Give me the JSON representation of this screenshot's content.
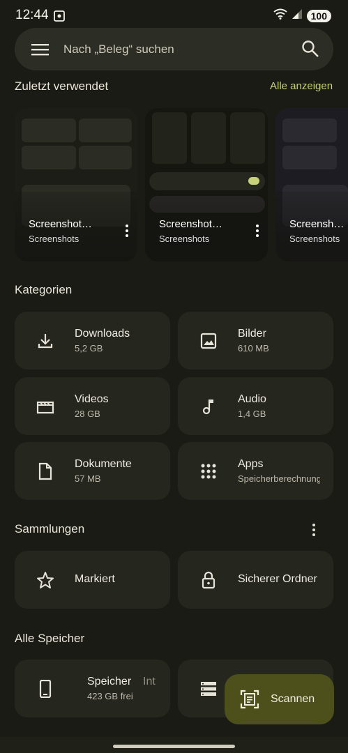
{
  "status_bar": {
    "time": "12:44",
    "battery": "100"
  },
  "search": {
    "placeholder": "Nach „Beleg“ suchen"
  },
  "recent": {
    "title": "Zuletzt verwendet",
    "show_all": "Alle anzeigen",
    "items": [
      {
        "title": "Screenshot…",
        "subtitle": "Screenshots"
      },
      {
        "title": "Screenshot…",
        "subtitle": "Screenshots"
      },
      {
        "title": "Screenshot…",
        "subtitle": "Screenshots"
      }
    ]
  },
  "categories": {
    "title": "Kategorien",
    "items": [
      {
        "label": "Downloads",
        "sub": "5,2 GB",
        "icon": "download-icon"
      },
      {
        "label": "Bilder",
        "sub": "610 MB",
        "icon": "image-icon"
      },
      {
        "label": "Videos",
        "sub": "28 GB",
        "icon": "movie-icon"
      },
      {
        "label": "Audio",
        "sub": "1,4 GB",
        "icon": "music-note-icon"
      },
      {
        "label": "Dokumente",
        "sub": "57 MB",
        "icon": "document-icon"
      },
      {
        "label": "Apps",
        "sub": "Speicherberechnung",
        "icon": "apps-grid-icon"
      }
    ]
  },
  "collections": {
    "title": "Sammlungen",
    "items": [
      {
        "label": "Markiert",
        "icon": "star-icon"
      },
      {
        "label": "Sicherer Ordner",
        "icon": "lock-icon"
      }
    ]
  },
  "storage": {
    "title": "Alle Speicher",
    "items": [
      {
        "label": "Speicher",
        "sub": "423 GB frei",
        "icon": "phone-icon"
      },
      {
        "label": "Int",
        "icon": "storage-icon"
      }
    ]
  },
  "fab": {
    "label": "Scannen",
    "icon": "document-scanner-icon"
  },
  "colors": {
    "background": "#1a1b14",
    "tile": "#25261e",
    "accent": "#c7d17a",
    "fab": "#4d501b"
  }
}
